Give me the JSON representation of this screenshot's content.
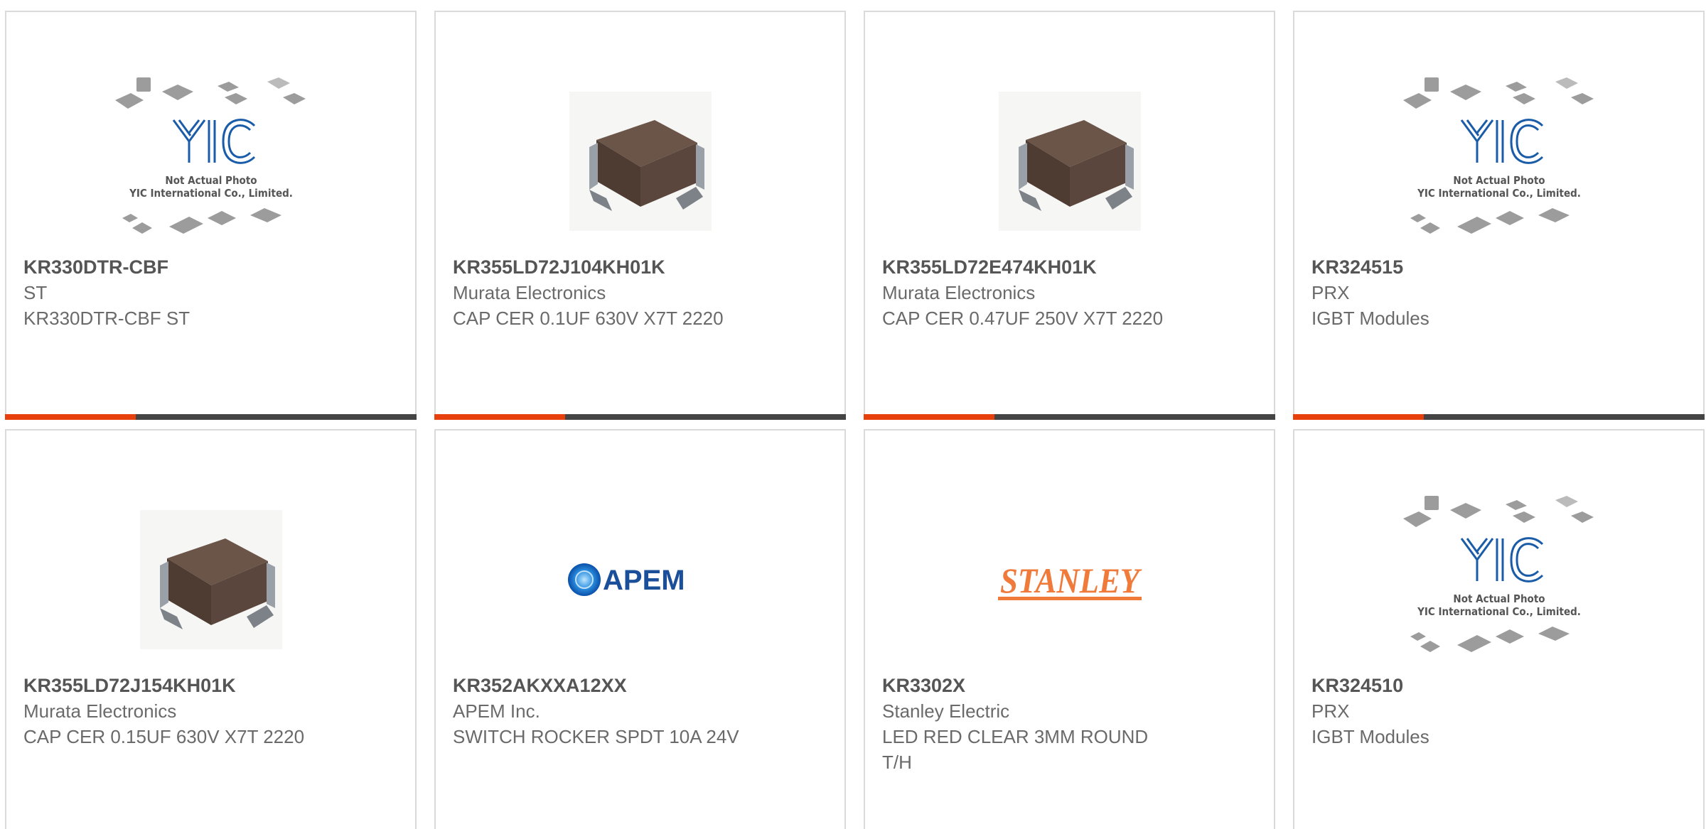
{
  "accent_color": "#e8400c",
  "bar_color": "#444444",
  "products": [
    {
      "part_number": "KR330DTR-CBF",
      "manufacturer": "ST",
      "description": "KR330DTR-CBF ST",
      "image": "yic-placeholder-image",
      "placeholder_title": "Not Actual Photo",
      "placeholder_company": "YIC International Co., Limited."
    },
    {
      "part_number": "KR355LD72J104KH01K",
      "manufacturer": "Murata Electronics",
      "description": "CAP CER 0.1UF 630V X7T 2220",
      "image": "ceramic-capacitor-image"
    },
    {
      "part_number": "KR355LD72E474KH01K",
      "manufacturer": "Murata Electronics",
      "description": "CAP CER 0.47UF 250V X7T 2220",
      "image": "ceramic-capacitor-image"
    },
    {
      "part_number": "KR324515",
      "manufacturer": "PRX",
      "description": "IGBT Modules",
      "image": "yic-placeholder-image",
      "placeholder_title": "Not Actual Photo",
      "placeholder_company": "YIC International Co., Limited."
    },
    {
      "part_number": "KR355LD72J154KH01K",
      "manufacturer": "Murata Electronics",
      "description": "CAP CER 0.15UF 630V X7T 2220",
      "image": "ceramic-capacitor-image"
    },
    {
      "part_number": "KR352AKXXA12XX",
      "manufacturer": "APEM Inc.",
      "description": "SWITCH ROCKER SPDT 10A 24V",
      "image": "apem-logo",
      "logo_text": "APEM"
    },
    {
      "part_number": "KR3302X",
      "manufacturer": "Stanley Electric",
      "description": "LED RED CLEAR 3MM ROUND T/H",
      "image": "stanley-logo",
      "logo_text": "STANLEY"
    },
    {
      "part_number": "KR324510",
      "manufacturer": "PRX",
      "description": "IGBT Modules",
      "image": "yic-placeholder-image",
      "placeholder_title": "Not Actual Photo",
      "placeholder_company": "YIC International Co., Limited."
    }
  ]
}
